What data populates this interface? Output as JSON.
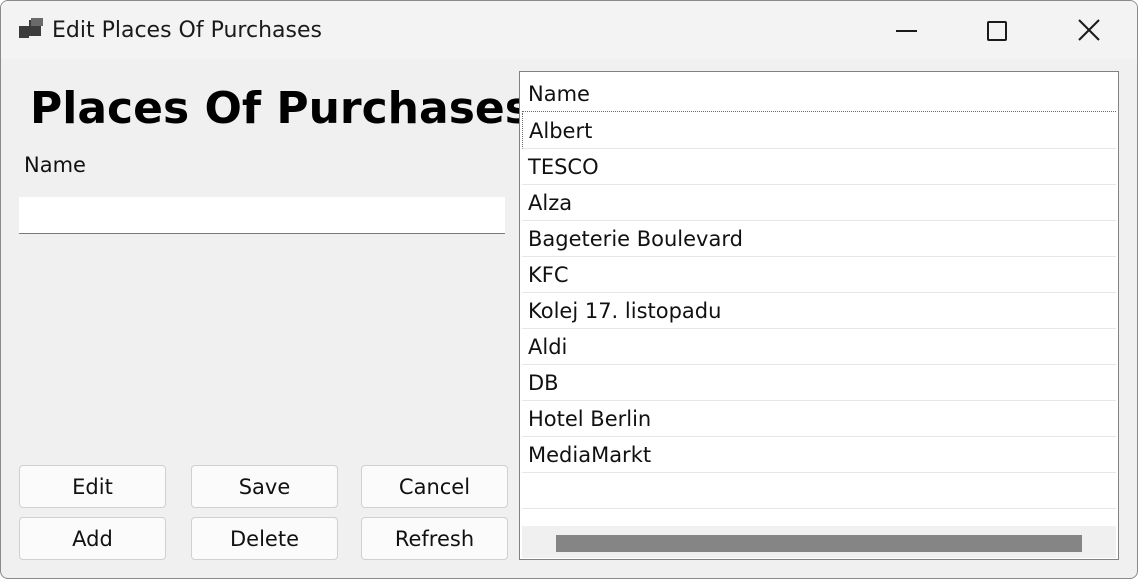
{
  "window": {
    "title": "Edit Places Of Purchases",
    "icon": "app-window-icon"
  },
  "form": {
    "heading": "Places Of Purchases",
    "name_label": "Name",
    "name_value": "",
    "name_placeholder": ""
  },
  "buttons": {
    "edit": "Edit",
    "save": "Save",
    "cancel": "Cancel",
    "add": "Add",
    "delete": "Delete",
    "refresh": "Refresh"
  },
  "list": {
    "column_header": "Name",
    "rows": [
      "Albert",
      "TESCO",
      "Alza",
      "Bageterie Boulevard",
      "KFC",
      "Kolej 17. listopadu",
      "Aldi",
      "DB",
      "Hotel Berlin",
      "MediaMarkt"
    ]
  }
}
